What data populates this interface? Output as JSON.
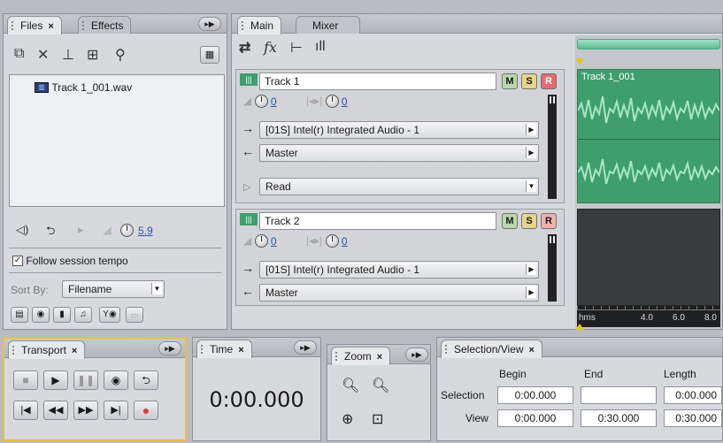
{
  "files_panel": {
    "tabs": [
      {
        "label": "Files"
      },
      {
        "label": "Effects"
      }
    ],
    "file_item": "Track 1_001.wav",
    "preview_volume": "5.9",
    "follow_tempo_label": "Follow session tempo",
    "sort_by_label": "Sort By:",
    "sort_by_value": "Filename"
  },
  "main_panel": {
    "tabs": [
      {
        "label": "Main"
      },
      {
        "label": "Mixer"
      }
    ],
    "toolbar": {
      "fx_label": "fx"
    },
    "tracks": [
      {
        "name": "Track 1",
        "volume": "0",
        "pan": "0",
        "input": "[01S] Intel(r) Integrated Audio - 1",
        "output": "Master",
        "automation": "Read",
        "mute": "M",
        "solo": "S",
        "record": "R"
      },
      {
        "name": "Track 2",
        "volume": "0",
        "pan": "0",
        "input": "[01S] Intel(r) Integrated Audio - 1",
        "output": "Master",
        "mute": "M",
        "solo": "S",
        "record": "R"
      }
    ],
    "clip_name": "Track 1_001",
    "timeline": {
      "unit": "hms",
      "ticks": [
        "4.0",
        "6.0",
        "8.0"
      ]
    }
  },
  "transport": {
    "title": "Transport"
  },
  "time": {
    "title": "Time",
    "value": "0:00.000"
  },
  "zoom": {
    "title": "Zoom"
  },
  "selection_view": {
    "title": "Selection/View",
    "headers": {
      "begin": "Begin",
      "end": "End",
      "length": "Length"
    },
    "selection": {
      "label": "Selection",
      "begin": "0:00.000",
      "end": "",
      "length": "0:00.000"
    },
    "view": {
      "label": "View",
      "begin": "0:00.000",
      "end": "0:30.000",
      "length": "0:30.000"
    }
  },
  "colors": {
    "clip": "#3f9e6d",
    "clip_dark": "#2e7d55",
    "empty_lane": "#3a3b3d",
    "record": "#e33b3b"
  }
}
